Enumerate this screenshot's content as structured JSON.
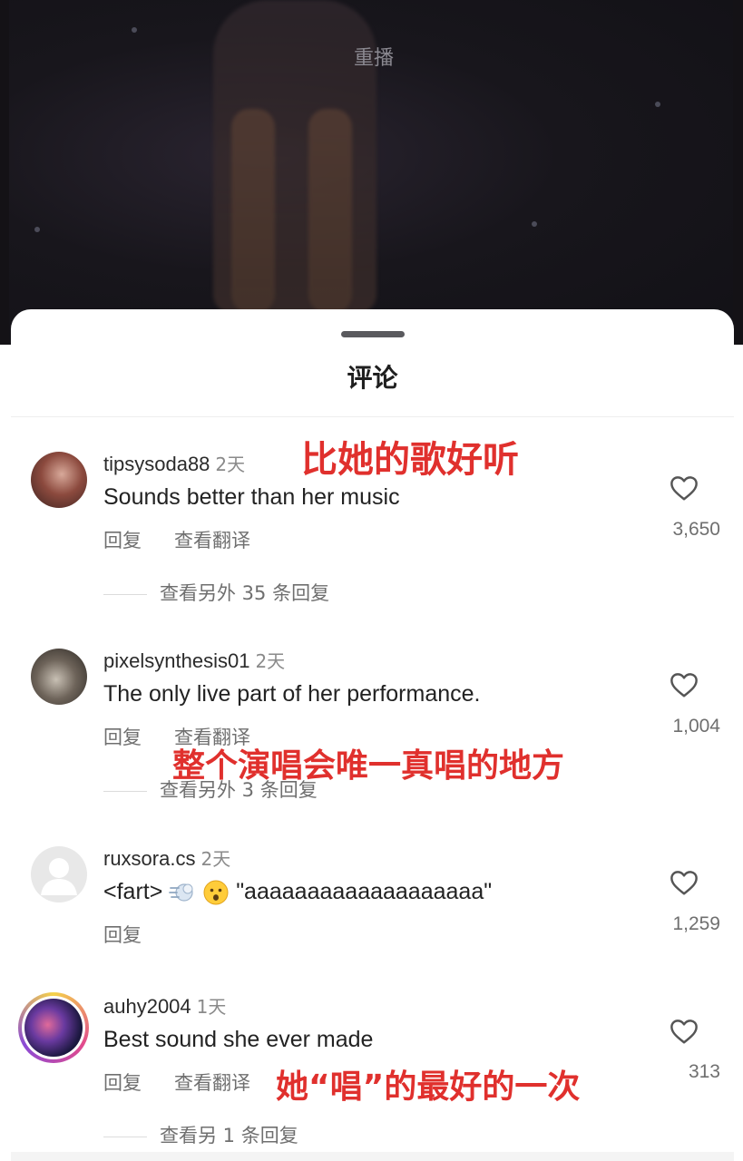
{
  "video": {
    "replay_label": "重播"
  },
  "sheet": {
    "title": "评论"
  },
  "comments": [
    {
      "username": "tipsysoda88",
      "time": "2天",
      "text": "Sounds better than her music",
      "reply_label": "回复",
      "translate_label": "查看翻译",
      "likes": "3,650",
      "more_replies": "查看另外 35 条回复",
      "annotation": "比她的歌好听"
    },
    {
      "username": "pixelsynthesis01",
      "time": "2天",
      "text": "The only live part of her performance.",
      "reply_label": "回复",
      "translate_label": "查看翻译",
      "likes": "1,004",
      "more_replies": "查看另外 3 条回复",
      "annotation": "整个演唱会唯一真唱的地方"
    },
    {
      "username": "ruxsora.cs",
      "time": "2天",
      "text_prefix": "<fart>",
      "text_suffix": "\"aaaaaaaaaaaaaaaaaaa\"",
      "emojis": [
        "dash-emoji",
        "frowning-face-emoji"
      ],
      "reply_label": "回复",
      "likes": "1,259"
    },
    {
      "username": "auhy2004",
      "time": "1天",
      "text": "Best sound she ever made",
      "reply_label": "回复",
      "translate_label": "查看翻译",
      "likes": "313",
      "more_replies": "查看另 1 条回复",
      "annotation": "她“唱”的最好的一次"
    }
  ],
  "colors": {
    "annotation": "#e0302d",
    "secondary_text": "#6f6f6f",
    "primary_text": "#222222"
  }
}
